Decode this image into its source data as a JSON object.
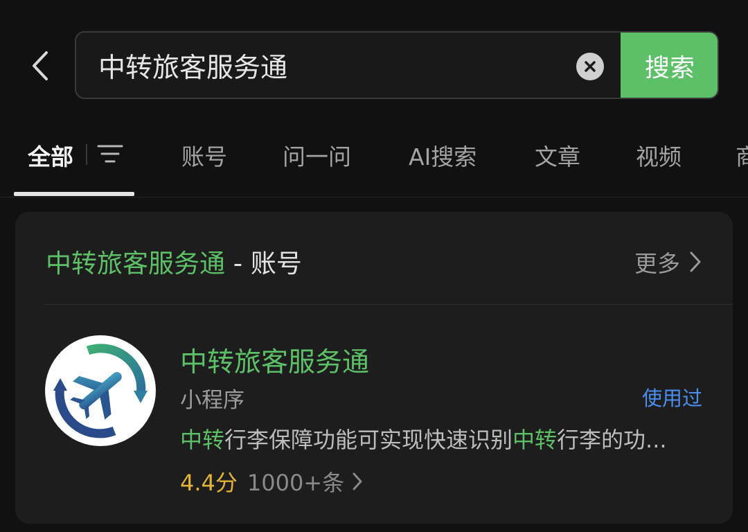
{
  "search": {
    "query": "中转旅客服务通",
    "button_label": "搜索"
  },
  "tabs": [
    {
      "label": "全部",
      "active": true
    },
    {
      "label": "账号"
    },
    {
      "label": "问一问"
    },
    {
      "label": "AI搜索"
    },
    {
      "label": "文章"
    },
    {
      "label": "视频"
    },
    {
      "label": "商"
    }
  ],
  "card": {
    "title_highlight": "中转旅客服务通",
    "title_suffix": " - 账号",
    "more_label": "更多",
    "result": {
      "name": "中转旅客服务通",
      "type": "小程序",
      "badge": "使用过",
      "desc_parts": [
        "中转",
        "行李保障功能可实现快速识别",
        "中转",
        "行李的功..."
      ],
      "rating": "4.4分",
      "reviews": "1000+条"
    }
  },
  "colors": {
    "accent_green": "#5dc068",
    "badge_blue": "#4c8df0",
    "rating_gold": "#e3b33a",
    "background": "#111111",
    "card": "#1d1d1d"
  },
  "icons": {
    "back": "chevron-left-icon",
    "clear": "clear-icon",
    "filter": "filter-icon",
    "more": "chevron-right-icon",
    "logo": "airplane-logo-icon"
  }
}
